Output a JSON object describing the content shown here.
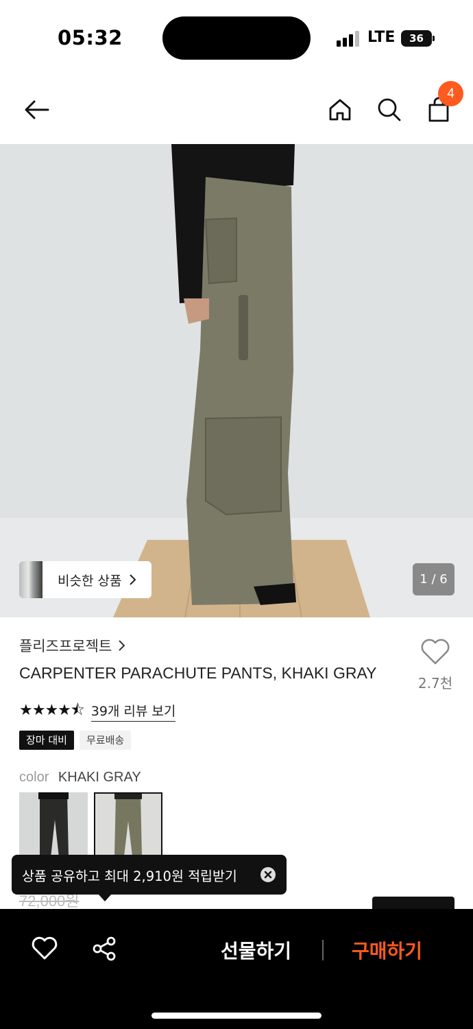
{
  "status_bar": {
    "time": "05:32",
    "network": "LTE",
    "battery": "36"
  },
  "nav": {
    "cart_count": "4",
    "icons": [
      "back-arrow-icon",
      "home-icon",
      "search-icon",
      "shopping-bag-icon"
    ]
  },
  "gallery": {
    "similar_label": "비슷한 상품",
    "pager": "1 / 6"
  },
  "product": {
    "brand": "플리즈프로젝트",
    "title": "CARPENTER PARACHUTE PANTS, KHAKI GRAY",
    "like_count": "2.7천",
    "review_link": "39개 리뷰 보기",
    "rating": 4.5,
    "tags": [
      "장마 대비",
      "무료배송"
    ],
    "color_label": "color",
    "color_value": "KHAKI GRAY",
    "original_price": "72,000원"
  },
  "tooltip": {
    "text": "상품 공유하고 최대 2,910원 적립받기"
  },
  "bottom_bar": {
    "gift_label": "선물하기",
    "buy_label": "구매하기"
  },
  "colors": {
    "accent": "#ff5a1f",
    "bar": "#000000"
  }
}
